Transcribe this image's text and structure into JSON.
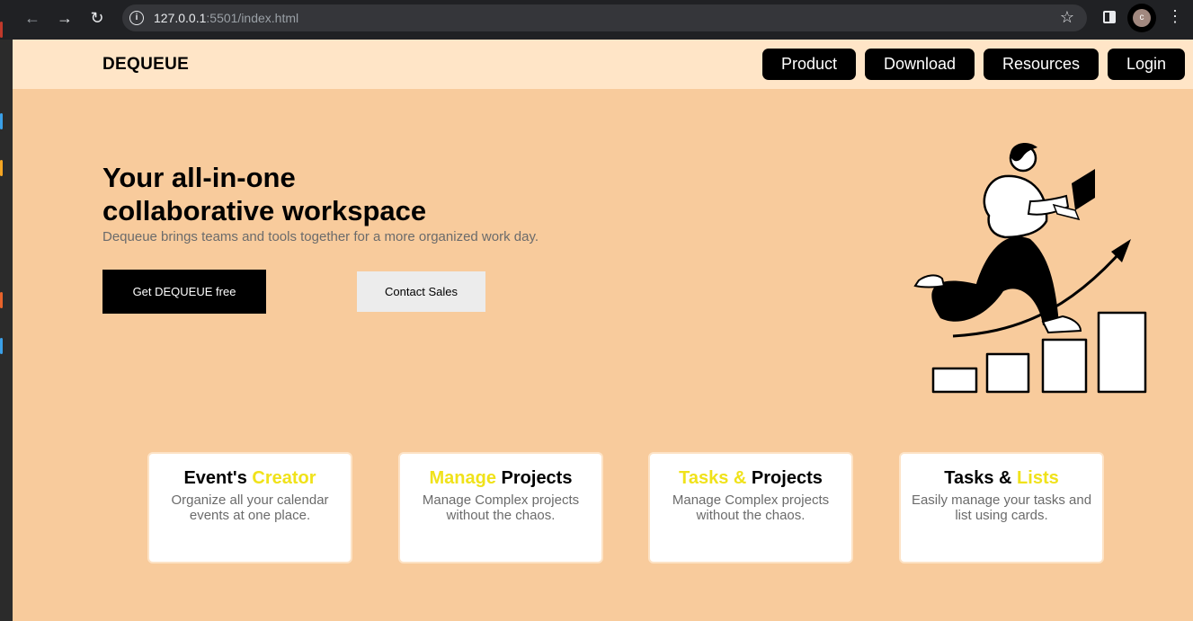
{
  "browser": {
    "url_host": "127.0.0.1",
    "url_rest": ":5501/index.html",
    "profile_initial": "c",
    "icons": {
      "back": "arrow-left-icon",
      "forward": "arrow-right-icon",
      "reload": "reload-icon",
      "info": "info-icon",
      "bookmark": "star-icon",
      "side_panel": "side-panel-icon",
      "menu": "kebab-menu-icon"
    }
  },
  "header": {
    "logo": "DEQUEUE",
    "nav": [
      "Product",
      "Download",
      "Resources",
      "Login"
    ]
  },
  "hero": {
    "title_line1": "Your all-in-one",
    "title_line2": "collaborative workspace",
    "subtitle": "Dequeue brings teams and tools together for a more organized work day.",
    "primary_cta": "Get DEQUEUE free",
    "secondary_cta": "Contact Sales"
  },
  "cards": [
    {
      "title_a": "Event's ",
      "title_b": "Creator",
      "desc": "Organize all your calendar events at one place."
    },
    {
      "title_a": "Manage",
      "title_b": " Projects",
      "desc": "Manage Complex projects without the chaos."
    },
    {
      "title_a": "Tasks &",
      "title_b": " Projects",
      "desc": "Manage Complex projects without the chaos."
    },
    {
      "title_a": "Tasks & ",
      "title_b": "Lists",
      "desc": "Easily manage your tasks and list using cards."
    }
  ],
  "colors": {
    "page_bg": "#f8cb9c",
    "header_bg": "#ffe5c7",
    "accent_yellow": "#f0e21a",
    "button_dark": "#000000"
  }
}
